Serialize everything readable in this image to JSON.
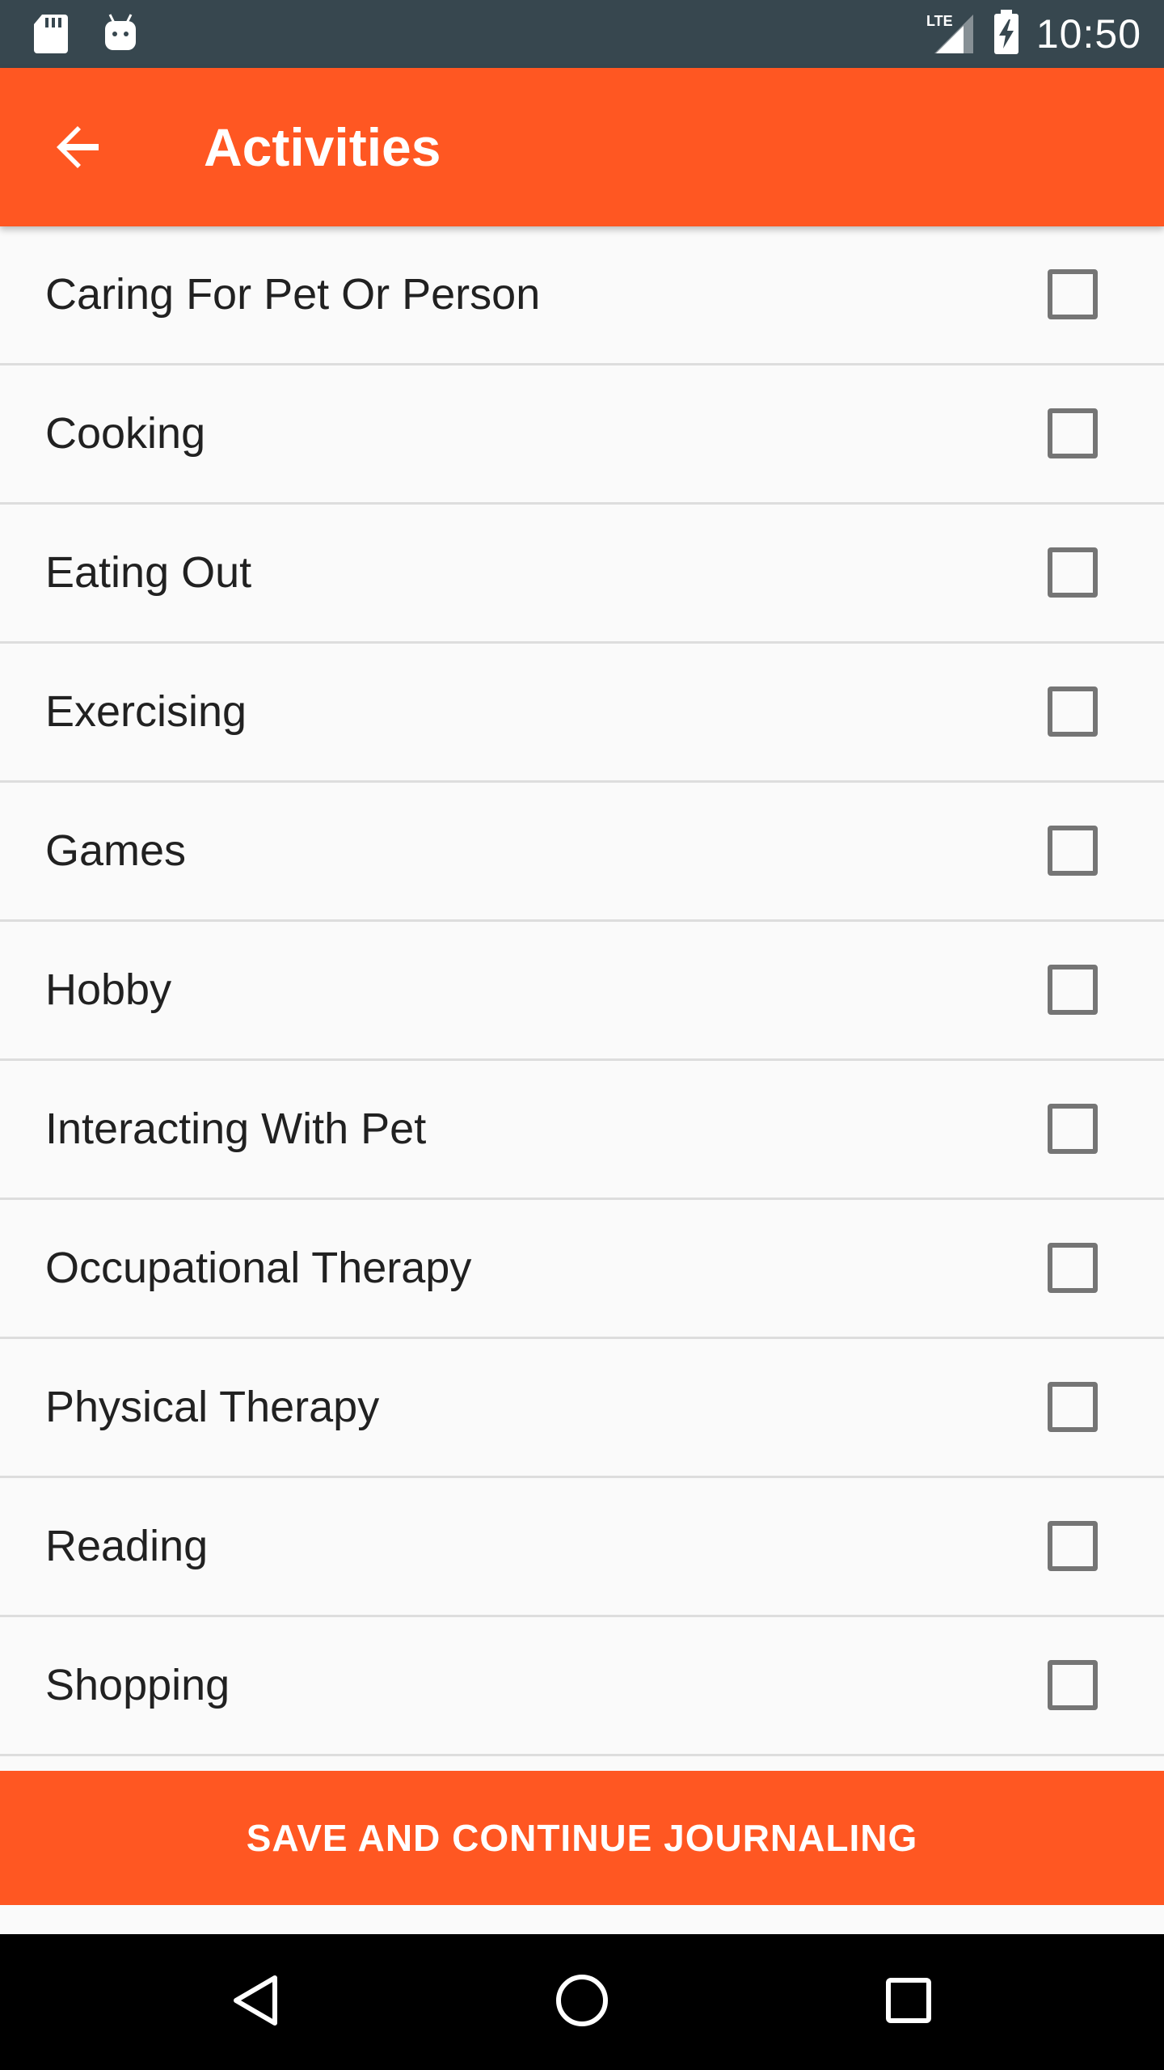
{
  "status_bar": {
    "time": "10:50",
    "network": "LTE",
    "icons": [
      "sd-card-icon",
      "android-icon",
      "lte-signal-icon",
      "battery-charging-icon"
    ]
  },
  "app_bar": {
    "title": "Activities",
    "back_icon": "arrow-back-icon",
    "color": "#ff5722"
  },
  "activities": [
    {
      "label": "Caring For Pet Or Person",
      "checked": false
    },
    {
      "label": "Cooking",
      "checked": false
    },
    {
      "label": "Eating Out",
      "checked": false
    },
    {
      "label": "Exercising",
      "checked": false
    },
    {
      "label": "Games",
      "checked": false
    },
    {
      "label": "Hobby",
      "checked": false
    },
    {
      "label": "Interacting With Pet",
      "checked": false
    },
    {
      "label": "Occupational Therapy",
      "checked": false
    },
    {
      "label": "Physical Therapy",
      "checked": false
    },
    {
      "label": "Reading",
      "checked": false
    },
    {
      "label": "Shopping",
      "checked": false
    }
  ],
  "save_button": {
    "label": "SAVE AND CONTINUE JOURNALING"
  },
  "nav_bar": {
    "icons": [
      "back-triangle-icon",
      "home-circle-icon",
      "recents-square-icon"
    ]
  }
}
